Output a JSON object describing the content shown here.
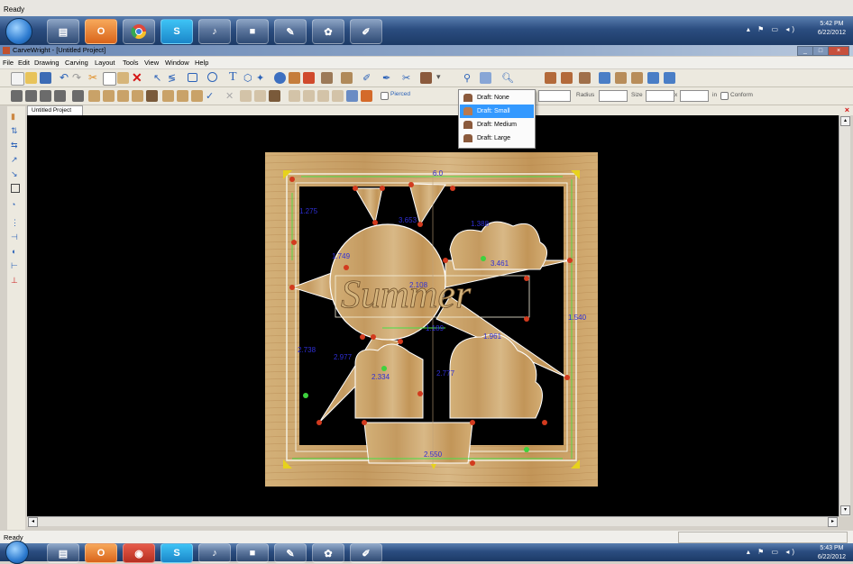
{
  "status_top": "Ready",
  "status_bottom": "Ready",
  "window": {
    "title": "CarveWright - [Untitled Project]"
  },
  "menu": [
    "File",
    "Edit",
    "Drawing",
    "Carving",
    "Layout",
    "Tools",
    "View",
    "Window",
    "Help"
  ],
  "toolbar2": {
    "pierced_label": "Pierced",
    "radius_label": "Radius",
    "size_label": "Size",
    "x_label": "x",
    "in_label": "in",
    "conform_label": "Conform"
  },
  "draft_menu": {
    "items": [
      "Draft: None",
      "Draft: Small",
      "Draft: Medium",
      "Draft: Large"
    ],
    "selected_index": 1
  },
  "document_tab": "Untitled Project",
  "canvas": {
    "word": "Summer",
    "dimensions": [
      "6.0",
      "1.275",
      "3.653",
      "1.388",
      "3.461",
      "1.749",
      "2.108",
      "1.189",
      "1.961",
      "1.540",
      "2.738",
      "2.977",
      "2.334",
      "2.777",
      "2.550"
    ]
  },
  "taskbar_top": {
    "time": "5:42 PM",
    "date": "6/22/2012"
  },
  "taskbar_bottom": {
    "time": "5:43 PM",
    "date": "6/22/2012"
  },
  "taskbar_apps": [
    "windows-explorer",
    "outlook",
    "chrome",
    "skype",
    "itunes",
    "media",
    "paint",
    "carvewright",
    "notepad"
  ],
  "colors": {
    "canvas_bg": "#000000",
    "wood": "#c9a268",
    "dim_text": "#2f2fd6",
    "selection": "#3399ff"
  }
}
